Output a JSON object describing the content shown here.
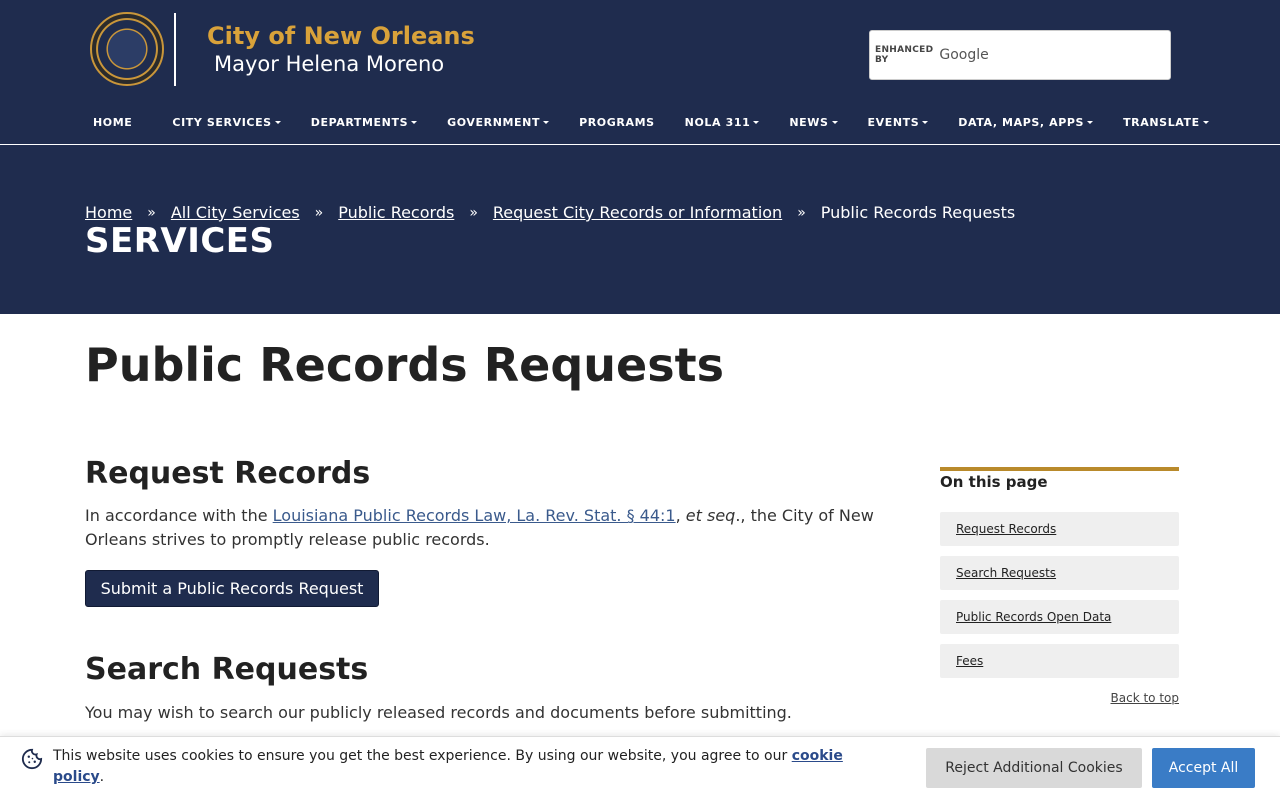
{
  "header": {
    "site_title": "City of New Orleans",
    "site_subtitle": "Mayor Helena Moreno",
    "seal_icon": "city-seal-icon",
    "search": {
      "enhanced_by": "ENHANCED BY",
      "google": "Google",
      "value": "",
      "placeholder": ""
    }
  },
  "nav": {
    "items": [
      {
        "label": "HOME",
        "dropdown": false
      },
      {
        "label": "CITY SERVICES",
        "dropdown": true
      },
      {
        "label": "DEPARTMENTS",
        "dropdown": true
      },
      {
        "label": "GOVERNMENT",
        "dropdown": true
      },
      {
        "label": "PROGRAMS",
        "dropdown": false
      },
      {
        "label": "NOLA 311",
        "dropdown": true
      },
      {
        "label": "NEWS",
        "dropdown": true
      },
      {
        "label": "EVENTS",
        "dropdown": true
      },
      {
        "label": "DATA, MAPS, APPS",
        "dropdown": true
      },
      {
        "label": "TRANSLATE",
        "dropdown": true
      }
    ]
  },
  "breadcrumb": {
    "separator": "»",
    "items": [
      {
        "label": "Home",
        "link": true
      },
      {
        "label": "All City Services",
        "link": true
      },
      {
        "label": "Public Records",
        "link": true
      },
      {
        "label": "Request City Records or Information",
        "link": true
      },
      {
        "label": "Public Records Requests",
        "link": false
      }
    ]
  },
  "hero": {
    "title": "SERVICES"
  },
  "main": {
    "page_title": "Public Records Requests",
    "request": {
      "heading": "Request Records",
      "text_before": "In accordance with the ",
      "law_link": "Louisiana Public Records Law, La. Rev. Stat. § 44:1",
      "comma": ", ",
      "et_seq": "et seq",
      "text_after": "., the City of New Orleans strives to promptly release public records.",
      "button_label": "Submit a Public Records Request"
    },
    "search_section": {
      "heading": "Search Requests",
      "text": "You may wish to search our publicly released records and documents before submitting."
    }
  },
  "on_this_page": {
    "title": "On this page",
    "items": [
      "Request Records",
      "Search Requests",
      "Public Records Open Data",
      "Fees"
    ],
    "back_to_top": "Back to top"
  },
  "cookie": {
    "icon": "cookie-icon",
    "text": "This website uses cookies to ensure you get the best experience. By using our website, you agree to our ",
    "policy_link": "cookie policy",
    "period": ".",
    "reject_label": "Reject Additional Cookies",
    "accept_label": "Accept All"
  },
  "colors": {
    "navy": "#1f2c4e",
    "gold": "#d9a23a",
    "accent_blue": "#3a7cc6"
  }
}
